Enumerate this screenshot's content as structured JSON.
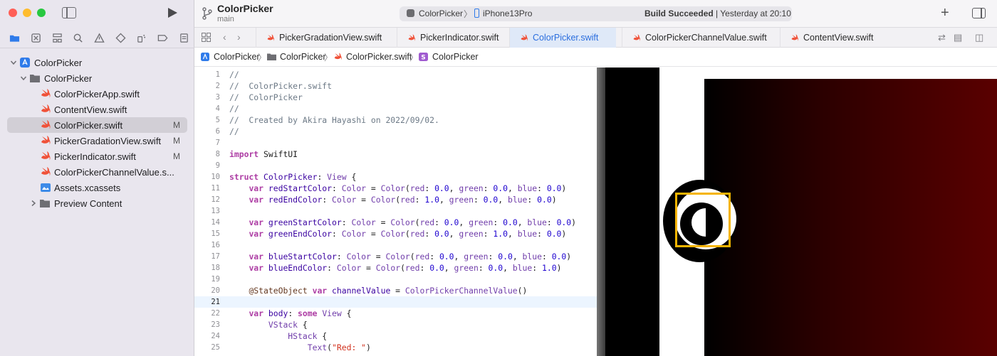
{
  "sidebar": {
    "tree": [
      {
        "label": "ColorPicker",
        "badge": ""
      },
      {
        "label": "ColorPicker",
        "badge": ""
      },
      {
        "label": "ColorPickerApp.swift",
        "badge": ""
      },
      {
        "label": "ContentView.swift",
        "badge": ""
      },
      {
        "label": "ColorPicker.swift",
        "badge": "M"
      },
      {
        "label": "PickerGradationView.swift",
        "badge": "M"
      },
      {
        "label": "PickerIndicator.swift",
        "badge": "M"
      },
      {
        "label": "ColorPickerChannelValue.s...",
        "badge": ""
      },
      {
        "label": "Assets.xcassets",
        "badge": ""
      },
      {
        "label": "Preview Content",
        "badge": ""
      }
    ]
  },
  "toolbar": {
    "project_title": "ColorPicker",
    "branch": "main",
    "scheme": "ColorPicker",
    "device": "iPhone13Pro",
    "build_status_bold": "Build Succeeded",
    "build_status_rest": " | Yesterday at 20:10",
    "plus": "+"
  },
  "tabs": [
    {
      "label": "PickerGradationView.swift"
    },
    {
      "label": "PickerIndicator.swift"
    },
    {
      "label": "ColorPicker.swift"
    },
    {
      "label": "ColorPickerChannelValue.swift"
    },
    {
      "label": "ContentView.swift"
    }
  ],
  "breadcrumb": [
    "ColorPicker",
    "ColorPicker",
    "ColorPicker.swift",
    "ColorPicker"
  ],
  "editor": {
    "current_line": 21,
    "lines": [
      {
        "n": "1",
        "segs": [
          [
            "c",
            "//"
          ]
        ]
      },
      {
        "n": "2",
        "segs": [
          [
            "c",
            "//  ColorPicker.swift"
          ]
        ]
      },
      {
        "n": "3",
        "segs": [
          [
            "c",
            "//  ColorPicker"
          ]
        ]
      },
      {
        "n": "4",
        "segs": [
          [
            "c",
            "//"
          ]
        ]
      },
      {
        "n": "5",
        "segs": [
          [
            "c",
            "//  Created by Akira Hayashi on 2022/09/02."
          ]
        ]
      },
      {
        "n": "6",
        "segs": [
          [
            "c",
            "//"
          ]
        ]
      },
      {
        "n": "7",
        "segs": []
      },
      {
        "n": "8",
        "segs": [
          [
            "k",
            "import"
          ],
          [
            "",
            " SwiftUI"
          ]
        ]
      },
      {
        "n": "9",
        "segs": []
      },
      {
        "n": "10",
        "segs": [
          [
            "k",
            "struct"
          ],
          [
            "",
            " "
          ],
          [
            "t",
            "ColorPicker"
          ],
          [
            "",
            ": "
          ],
          [
            "v",
            "View"
          ],
          [
            "",
            " {"
          ]
        ]
      },
      {
        "n": "11",
        "segs": [
          [
            "",
            "    "
          ],
          [
            "k",
            "var"
          ],
          [
            "",
            " "
          ],
          [
            "t",
            "redStartColor"
          ],
          [
            "",
            ": "
          ],
          [
            "v",
            "Color"
          ],
          [
            "",
            " = "
          ],
          [
            "v",
            "Color"
          ],
          [
            "",
            "("
          ],
          [
            "v",
            "red"
          ],
          [
            "",
            ": "
          ],
          [
            "n",
            "0.0"
          ],
          [
            "",
            ", "
          ],
          [
            "v",
            "green"
          ],
          [
            "",
            ": "
          ],
          [
            "n",
            "0.0"
          ],
          [
            "",
            ", "
          ],
          [
            "v",
            "blue"
          ],
          [
            "",
            ": "
          ],
          [
            "n",
            "0.0"
          ],
          [
            "",
            ")"
          ]
        ]
      },
      {
        "n": "12",
        "segs": [
          [
            "",
            "    "
          ],
          [
            "k",
            "var"
          ],
          [
            "",
            " "
          ],
          [
            "t",
            "redEndColor"
          ],
          [
            "",
            ": "
          ],
          [
            "v",
            "Color"
          ],
          [
            "",
            " = "
          ],
          [
            "v",
            "Color"
          ],
          [
            "",
            "("
          ],
          [
            "v",
            "red"
          ],
          [
            "",
            ": "
          ],
          [
            "n",
            "1.0"
          ],
          [
            "",
            ", "
          ],
          [
            "v",
            "green"
          ],
          [
            "",
            ": "
          ],
          [
            "n",
            "0.0"
          ],
          [
            "",
            ", "
          ],
          [
            "v",
            "blue"
          ],
          [
            "",
            ": "
          ],
          [
            "n",
            "0.0"
          ],
          [
            "",
            ")"
          ]
        ]
      },
      {
        "n": "13",
        "segs": []
      },
      {
        "n": "14",
        "segs": [
          [
            "",
            "    "
          ],
          [
            "k",
            "var"
          ],
          [
            "",
            " "
          ],
          [
            "t",
            "greenStartColor"
          ],
          [
            "",
            ": "
          ],
          [
            "v",
            "Color"
          ],
          [
            "",
            " = "
          ],
          [
            "v",
            "Color"
          ],
          [
            "",
            "("
          ],
          [
            "v",
            "red"
          ],
          [
            "",
            ": "
          ],
          [
            "n",
            "0.0"
          ],
          [
            "",
            ", "
          ],
          [
            "v",
            "green"
          ],
          [
            "",
            ": "
          ],
          [
            "n",
            "0.0"
          ],
          [
            "",
            ", "
          ],
          [
            "v",
            "blue"
          ],
          [
            "",
            ": "
          ],
          [
            "n",
            "0.0"
          ],
          [
            "",
            ")"
          ]
        ]
      },
      {
        "n": "15",
        "segs": [
          [
            "",
            "    "
          ],
          [
            "k",
            "var"
          ],
          [
            "",
            " "
          ],
          [
            "t",
            "greenEndColor"
          ],
          [
            "",
            ": "
          ],
          [
            "v",
            "Color"
          ],
          [
            "",
            " = "
          ],
          [
            "v",
            "Color"
          ],
          [
            "",
            "("
          ],
          [
            "v",
            "red"
          ],
          [
            "",
            ": "
          ],
          [
            "n",
            "0.0"
          ],
          [
            "",
            ", "
          ],
          [
            "v",
            "green"
          ],
          [
            "",
            ": "
          ],
          [
            "n",
            "1.0"
          ],
          [
            "",
            ", "
          ],
          [
            "v",
            "blue"
          ],
          [
            "",
            ": "
          ],
          [
            "n",
            "0.0"
          ],
          [
            "",
            ")"
          ]
        ]
      },
      {
        "n": "16",
        "segs": []
      },
      {
        "n": "17",
        "segs": [
          [
            "",
            "    "
          ],
          [
            "k",
            "var"
          ],
          [
            "",
            " "
          ],
          [
            "t",
            "blueStartColor"
          ],
          [
            "",
            ": "
          ],
          [
            "v",
            "Color"
          ],
          [
            "",
            " = "
          ],
          [
            "v",
            "Color"
          ],
          [
            "",
            "("
          ],
          [
            "v",
            "red"
          ],
          [
            "",
            ": "
          ],
          [
            "n",
            "0.0"
          ],
          [
            "",
            ", "
          ],
          [
            "v",
            "green"
          ],
          [
            "",
            ": "
          ],
          [
            "n",
            "0.0"
          ],
          [
            "",
            ", "
          ],
          [
            "v",
            "blue"
          ],
          [
            "",
            ": "
          ],
          [
            "n",
            "0.0"
          ],
          [
            "",
            ")"
          ]
        ]
      },
      {
        "n": "18",
        "segs": [
          [
            "",
            "    "
          ],
          [
            "k",
            "var"
          ],
          [
            "",
            " "
          ],
          [
            "t",
            "blueEndColor"
          ],
          [
            "",
            ": "
          ],
          [
            "v",
            "Color"
          ],
          [
            "",
            " = "
          ],
          [
            "v",
            "Color"
          ],
          [
            "",
            "("
          ],
          [
            "v",
            "red"
          ],
          [
            "",
            ": "
          ],
          [
            "n",
            "0.0"
          ],
          [
            "",
            ", "
          ],
          [
            "v",
            "green"
          ],
          [
            "",
            ": "
          ],
          [
            "n",
            "0.0"
          ],
          [
            "",
            ", "
          ],
          [
            "v",
            "blue"
          ],
          [
            "",
            ": "
          ],
          [
            "n",
            "1.0"
          ],
          [
            "",
            ")"
          ]
        ]
      },
      {
        "n": "19",
        "segs": []
      },
      {
        "n": "20",
        "segs": [
          [
            "",
            "    "
          ],
          [
            "p",
            "@StateObject"
          ],
          [
            "",
            " "
          ],
          [
            "k",
            "var"
          ],
          [
            "",
            " "
          ],
          [
            "t",
            "channelValue"
          ],
          [
            "",
            " = "
          ],
          [
            "v",
            "ColorPickerChannelValue"
          ],
          [
            "",
            "()"
          ]
        ]
      },
      {
        "n": "21",
        "segs": []
      },
      {
        "n": "22",
        "segs": [
          [
            "",
            "    "
          ],
          [
            "k",
            "var"
          ],
          [
            "",
            " "
          ],
          [
            "t",
            "body"
          ],
          [
            "",
            ": "
          ],
          [
            "k",
            "some"
          ],
          [
            "",
            " "
          ],
          [
            "v",
            "View"
          ],
          [
            "",
            " {"
          ]
        ]
      },
      {
        "n": "23",
        "segs": [
          [
            "",
            "        "
          ],
          [
            "v",
            "VStack"
          ],
          [
            "",
            " {"
          ]
        ]
      },
      {
        "n": "24",
        "segs": [
          [
            "",
            "            "
          ],
          [
            "v",
            "HStack"
          ],
          [
            "",
            " {"
          ]
        ]
      },
      {
        "n": "25",
        "segs": [
          [
            "",
            "                "
          ],
          [
            "v",
            "Text"
          ],
          [
            "",
            "("
          ],
          [
            "s",
            "\"Red: \""
          ],
          [
            "",
            ")"
          ]
        ]
      }
    ]
  },
  "colors": {
    "accent": "#2b6ede",
    "selection": "#f5b400",
    "swift_orange": "#f05138"
  }
}
